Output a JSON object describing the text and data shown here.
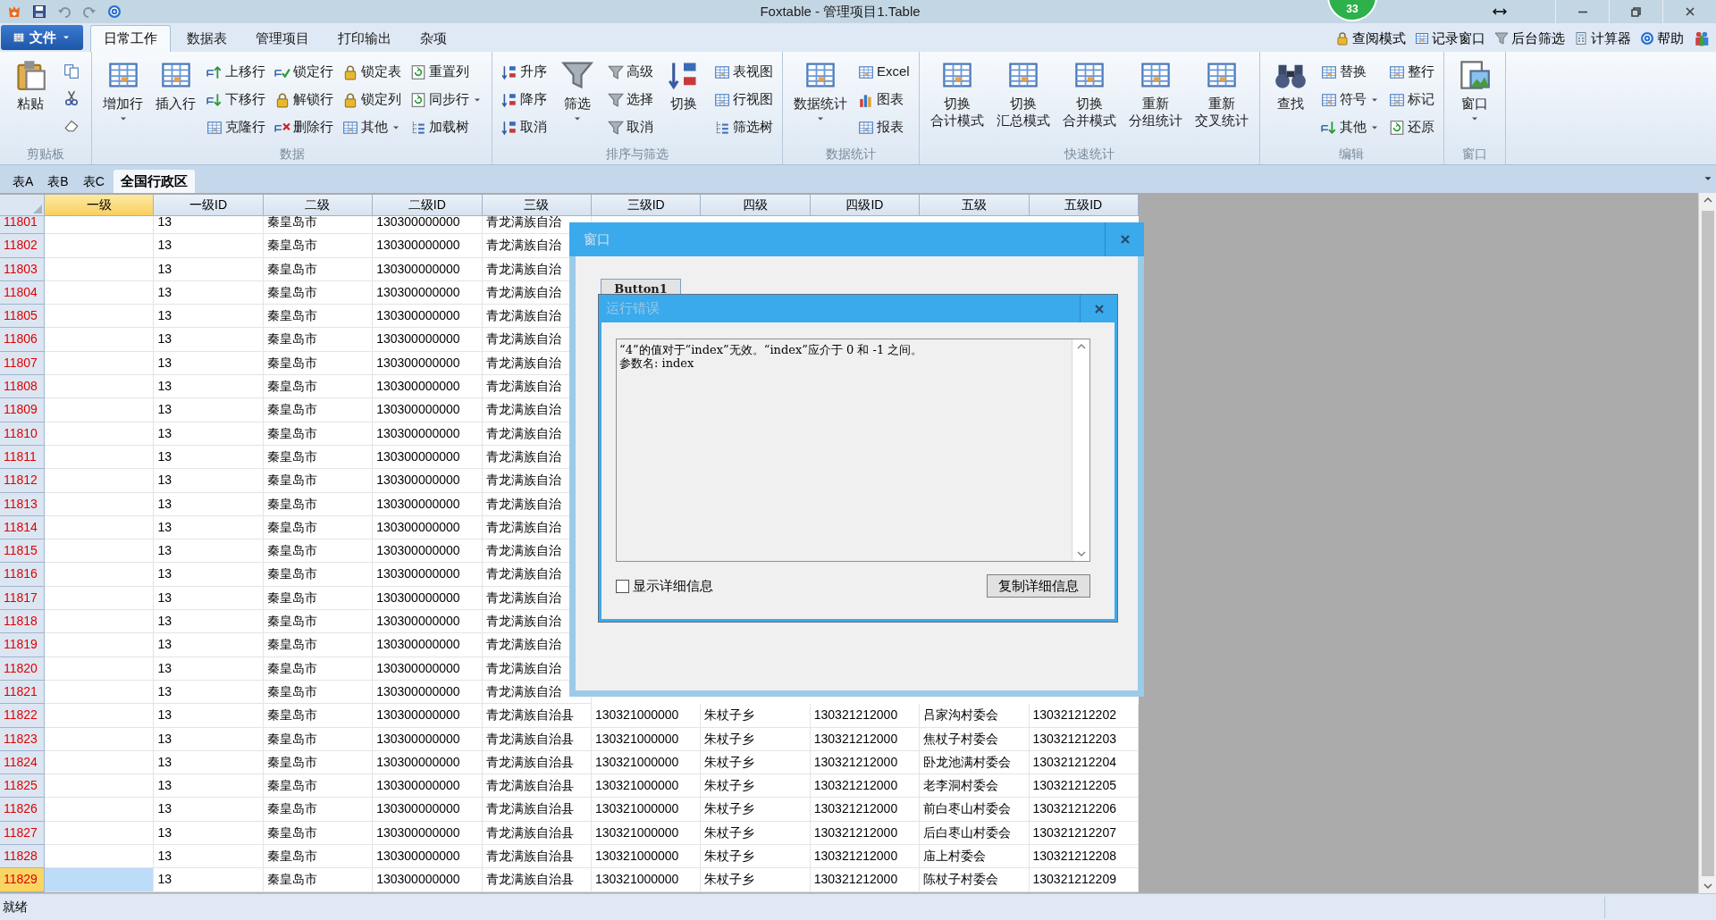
{
  "window": {
    "title": "Foxtable - 管理项目1.Table",
    "badge": "33"
  },
  "ribbon_tabs": {
    "file": "文件",
    "tabs": [
      {
        "label": "日常工作",
        "selected": true
      },
      {
        "label": "数据表",
        "selected": false
      },
      {
        "label": "管理项目",
        "selected": false
      },
      {
        "label": "打印输出",
        "selected": false
      },
      {
        "label": "杂项",
        "selected": false
      }
    ]
  },
  "quick_links": [
    "查阅模式",
    "记录窗口",
    "后台筛选",
    "计算器",
    "帮助"
  ],
  "ribbon_groups": [
    {
      "label": "剪贴板",
      "items": [
        {
          "kind": "large",
          "lines": [
            "粘贴"
          ],
          "dropdown": false
        },
        {
          "kind": "icons"
        }
      ]
    },
    {
      "label": "数据",
      "items": [
        {
          "kind": "large",
          "lines": [
            "增加行"
          ],
          "dropdown": true
        },
        {
          "kind": "large",
          "lines": [
            "插入行"
          ],
          "dropdown": false
        },
        {
          "kind": "stack",
          "items": [
            {
              "label": "上移行",
              "dropdown": false
            },
            {
              "label": "下移行",
              "dropdown": false
            },
            {
              "label": "克隆行",
              "dropdown": false
            }
          ]
        },
        {
          "kind": "stack",
          "items": [
            {
              "label": "锁定行",
              "dropdown": false
            },
            {
              "label": "解锁行",
              "dropdown": false
            },
            {
              "label": "删除行",
              "dropdown": false
            }
          ]
        },
        {
          "kind": "stack",
          "items": [
            {
              "label": "锁定表",
              "dropdown": false
            },
            {
              "label": "锁定列",
              "dropdown": false
            },
            {
              "label": "其他",
              "dropdown": true
            }
          ]
        },
        {
          "kind": "stack",
          "items": [
            {
              "label": "重置列",
              "dropdown": false
            },
            {
              "label": "同步行",
              "dropdown": true
            },
            {
              "label": "加载树",
              "dropdown": false
            }
          ]
        }
      ]
    },
    {
      "label": "排序与筛选",
      "items": [
        {
          "kind": "stack",
          "items": [
            {
              "label": "升序",
              "dropdown": false
            },
            {
              "label": "降序",
              "dropdown": false
            },
            {
              "label": "取消",
              "dropdown": false
            }
          ]
        },
        {
          "kind": "large",
          "lines": [
            "筛选"
          ],
          "dropdown": true
        },
        {
          "kind": "stack",
          "items": [
            {
              "label": "高级",
              "dropdown": false
            },
            {
              "label": "选择",
              "dropdown": false
            },
            {
              "label": "取消",
              "dropdown": false
            }
          ]
        },
        {
          "kind": "large",
          "lines": [
            "切换"
          ],
          "dropdown": false
        },
        {
          "kind": "stack",
          "items": [
            {
              "label": "表视图",
              "dropdown": false
            },
            {
              "label": "行视图",
              "dropdown": false
            },
            {
              "label": "筛选树",
              "dropdown": false
            }
          ]
        }
      ]
    },
    {
      "label": "数据统计",
      "items": [
        {
          "kind": "large",
          "lines": [
            "数据统计"
          ],
          "dropdown": true
        },
        {
          "kind": "stack",
          "items": [
            {
              "label": "Excel",
              "dropdown": false
            },
            {
              "label": "图表",
              "dropdown": false
            },
            {
              "label": "报表",
              "dropdown": false
            }
          ]
        }
      ]
    },
    {
      "label": "快速统计",
      "items": [
        {
          "kind": "large",
          "lines": [
            "切换",
            "合计模式"
          ],
          "dropdown": false
        },
        {
          "kind": "large",
          "lines": [
            "切换",
            "汇总模式"
          ],
          "dropdown": false
        },
        {
          "kind": "large",
          "lines": [
            "切换",
            "合并模式"
          ],
          "dropdown": false
        },
        {
          "kind": "large",
          "lines": [
            "重新",
            "分组统计"
          ],
          "dropdown": false
        },
        {
          "kind": "large",
          "lines": [
            "重新",
            "交叉统计"
          ],
          "dropdown": false
        }
      ]
    },
    {
      "label": "编辑",
      "items": [
        {
          "kind": "large",
          "lines": [
            "查找"
          ],
          "dropdown": false
        },
        {
          "kind": "stack",
          "items": [
            {
              "label": "替换",
              "dropdown": false
            },
            {
              "label": "符号",
              "dropdown": true
            },
            {
              "label": "其他",
              "dropdown": true
            }
          ]
        },
        {
          "kind": "stack",
          "items": [
            {
              "label": "整行",
              "dropdown": false
            },
            {
              "label": "标记",
              "dropdown": false
            },
            {
              "label": "还原",
              "dropdown": false
            }
          ]
        }
      ]
    },
    {
      "label": "窗口",
      "items": [
        {
          "kind": "large",
          "lines": [
            "窗口"
          ],
          "dropdown": true
        }
      ]
    }
  ],
  "sheet_tabs": [
    {
      "label": "表A",
      "selected": false
    },
    {
      "label": "表B",
      "selected": false
    },
    {
      "label": "表C",
      "selected": false
    },
    {
      "label": "全国行政区",
      "selected": true
    }
  ],
  "table": {
    "columns": [
      {
        "label": "一级",
        "selected": true
      },
      {
        "label": "一级ID",
        "selected": false
      },
      {
        "label": "二级",
        "selected": false
      },
      {
        "label": "二级ID",
        "selected": false
      },
      {
        "label": "三级",
        "selected": false
      },
      {
        "label": "三级ID",
        "selected": false
      },
      {
        "label": "四级",
        "selected": false
      },
      {
        "label": "四级ID",
        "selected": false
      },
      {
        "label": "五级",
        "selected": false
      },
      {
        "label": "五级ID",
        "selected": false
      }
    ],
    "rows": [
      {
        "number": "11801",
        "selected": false,
        "cells": [
          "",
          "13",
          "秦皇岛市",
          "130300000000",
          "青龙满族自治"
        ]
      },
      {
        "number": "11802",
        "selected": false,
        "cells": [
          "",
          "13",
          "秦皇岛市",
          "130300000000",
          "青龙满族自治"
        ]
      },
      {
        "number": "11803",
        "selected": false,
        "cells": [
          "",
          "13",
          "秦皇岛市",
          "130300000000",
          "青龙满族自治"
        ]
      },
      {
        "number": "11804",
        "selected": false,
        "cells": [
          "",
          "13",
          "秦皇岛市",
          "130300000000",
          "青龙满族自治"
        ]
      },
      {
        "number": "11805",
        "selected": false,
        "cells": [
          "",
          "13",
          "秦皇岛市",
          "130300000000",
          "青龙满族自治"
        ]
      },
      {
        "number": "11806",
        "selected": false,
        "cells": [
          "",
          "13",
          "秦皇岛市",
          "130300000000",
          "青龙满族自治"
        ]
      },
      {
        "number": "11807",
        "selected": false,
        "cells": [
          "",
          "13",
          "秦皇岛市",
          "130300000000",
          "青龙满族自治"
        ]
      },
      {
        "number": "11808",
        "selected": false,
        "cells": [
          "",
          "13",
          "秦皇岛市",
          "130300000000",
          "青龙满族自治"
        ]
      },
      {
        "number": "11809",
        "selected": false,
        "cells": [
          "",
          "13",
          "秦皇岛市",
          "130300000000",
          "青龙满族自治"
        ]
      },
      {
        "number": "11810",
        "selected": false,
        "cells": [
          "",
          "13",
          "秦皇岛市",
          "130300000000",
          "青龙满族自治"
        ]
      },
      {
        "number": "11811",
        "selected": false,
        "cells": [
          "",
          "13",
          "秦皇岛市",
          "130300000000",
          "青龙满族自治"
        ]
      },
      {
        "number": "11812",
        "selected": false,
        "cells": [
          "",
          "13",
          "秦皇岛市",
          "130300000000",
          "青龙满族自治"
        ]
      },
      {
        "number": "11813",
        "selected": false,
        "cells": [
          "",
          "13",
          "秦皇岛市",
          "130300000000",
          "青龙满族自治"
        ]
      },
      {
        "number": "11814",
        "selected": false,
        "cells": [
          "",
          "13",
          "秦皇岛市",
          "130300000000",
          "青龙满族自治"
        ]
      },
      {
        "number": "11815",
        "selected": false,
        "cells": [
          "",
          "13",
          "秦皇岛市",
          "130300000000",
          "青龙满族自治"
        ]
      },
      {
        "number": "11816",
        "selected": false,
        "cells": [
          "",
          "13",
          "秦皇岛市",
          "130300000000",
          "青龙满族自治"
        ]
      },
      {
        "number": "11817",
        "selected": false,
        "cells": [
          "",
          "13",
          "秦皇岛市",
          "130300000000",
          "青龙满族自治"
        ]
      },
      {
        "number": "11818",
        "selected": false,
        "cells": [
          "",
          "13",
          "秦皇岛市",
          "130300000000",
          "青龙满族自治"
        ]
      },
      {
        "number": "11819",
        "selected": false,
        "cells": [
          "",
          "13",
          "秦皇岛市",
          "130300000000",
          "青龙满族自治"
        ]
      },
      {
        "number": "11820",
        "selected": false,
        "cells": [
          "",
          "13",
          "秦皇岛市",
          "130300000000",
          "青龙满族自治"
        ]
      },
      {
        "number": "11821",
        "selected": false,
        "cells": [
          "",
          "13",
          "秦皇岛市",
          "130300000000",
          "青龙满族自治"
        ]
      },
      {
        "number": "11822",
        "selected": false,
        "cells": [
          "",
          "13",
          "秦皇岛市",
          "130300000000",
          "青龙满族自治县",
          "130321000000",
          "朱杖子乡",
          "130321212000",
          "吕家沟村委会",
          "130321212202"
        ]
      },
      {
        "number": "11823",
        "selected": false,
        "cells": [
          "",
          "13",
          "秦皇岛市",
          "130300000000",
          "青龙满族自治县",
          "130321000000",
          "朱杖子乡",
          "130321212000",
          "焦杖子村委会",
          "130321212203"
        ]
      },
      {
        "number": "11824",
        "selected": false,
        "cells": [
          "",
          "13",
          "秦皇岛市",
          "130300000000",
          "青龙满族自治县",
          "130321000000",
          "朱杖子乡",
          "130321212000",
          "卧龙池满村委会",
          "130321212204"
        ]
      },
      {
        "number": "11825",
        "selected": false,
        "cells": [
          "",
          "13",
          "秦皇岛市",
          "130300000000",
          "青龙满族自治县",
          "130321000000",
          "朱杖子乡",
          "130321212000",
          "老李洞村委会",
          "130321212205"
        ]
      },
      {
        "number": "11826",
        "selected": false,
        "cells": [
          "",
          "13",
          "秦皇岛市",
          "130300000000",
          "青龙满族自治县",
          "130321000000",
          "朱杖子乡",
          "130321212000",
          "前白枣山村委会",
          "130321212206"
        ]
      },
      {
        "number": "11827",
        "selected": false,
        "cells": [
          "",
          "13",
          "秦皇岛市",
          "130300000000",
          "青龙满族自治县",
          "130321000000",
          "朱杖子乡",
          "130321212000",
          "后白枣山村委会",
          "130321212207"
        ]
      },
      {
        "number": "11828",
        "selected": false,
        "cells": [
          "",
          "13",
          "秦皇岛市",
          "130300000000",
          "青龙满族自治县",
          "130321000000",
          "朱杖子乡",
          "130321212000",
          "庙上村委会",
          "130321212208"
        ]
      },
      {
        "number": "11829",
        "selected": true,
        "cells": [
          "",
          "13",
          "秦皇岛市",
          "130300000000",
          "青龙满族自治县",
          "130321000000",
          "朱杖子乡",
          "130321212000",
          "陈杖子村委会",
          "130321212209"
        ]
      }
    ]
  },
  "window_dialog": {
    "title": "窗口",
    "button": "Button1"
  },
  "error_dialog": {
    "title": "运行错误",
    "message_lines": [
      "“4”的值对于“index”无效。“index”应介于 0 和 -1 之间。",
      "参数名: index"
    ],
    "show_details": {
      "label": "显示详细信息",
      "checked": false
    },
    "copy_button": "复制详细信息"
  },
  "status_bar": {
    "text": "就绪"
  }
}
